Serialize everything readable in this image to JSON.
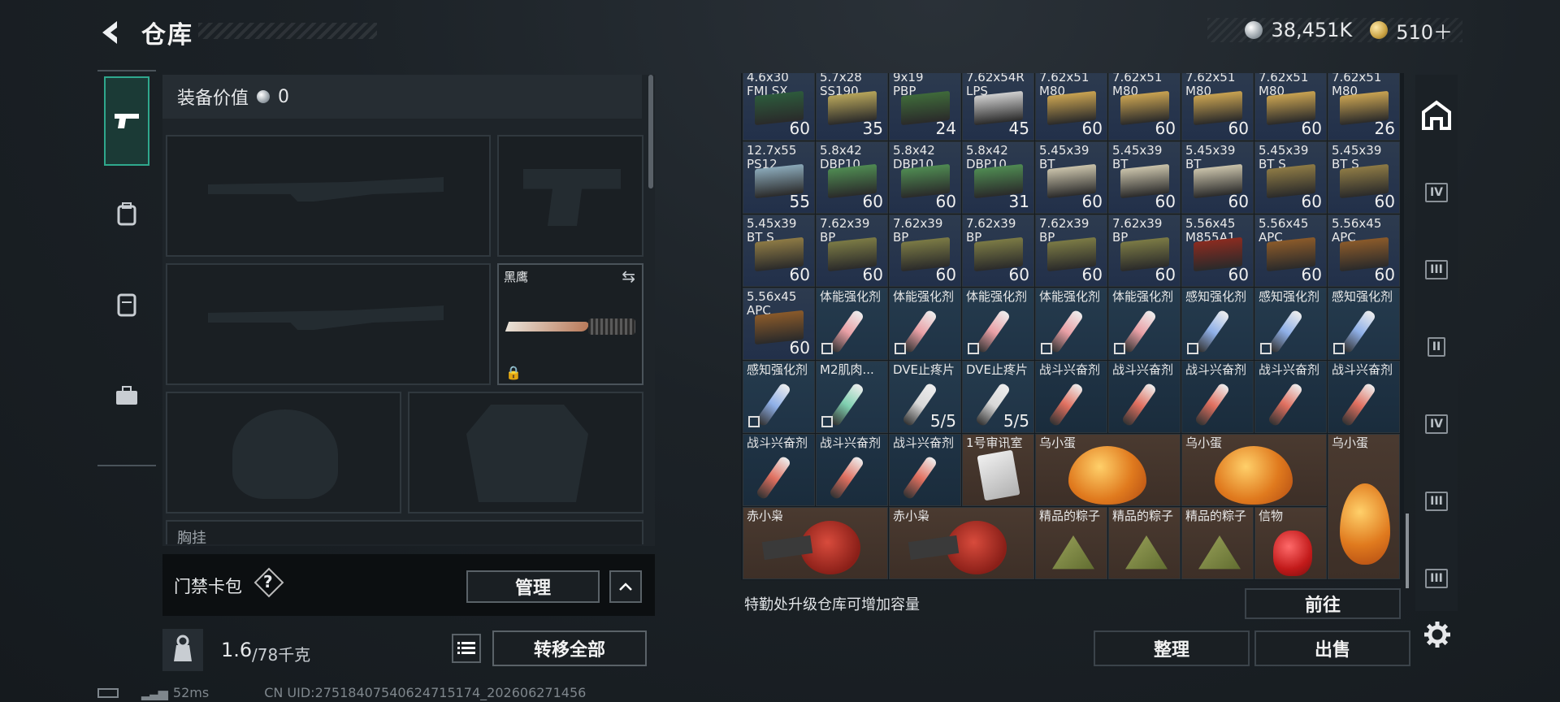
{
  "header": {
    "title": "仓库",
    "silver": "38,451K",
    "gold": "510＋"
  },
  "left_tabs": [
    {
      "name": "loadout-tab",
      "icon": "pistol-icon"
    },
    {
      "name": "backpack-tab",
      "icon": "backpack-icon"
    },
    {
      "name": "vest-tab",
      "icon": "vest-icon"
    },
    {
      "name": "case-tab",
      "icon": "briefcase-icon"
    }
  ],
  "loadout": {
    "equip_value_label": "装备价值",
    "equip_value": "0",
    "knife_name": "黑鹰",
    "chest_label": "胸挂",
    "keycard_label": "门禁卡包",
    "manage_label": "管理",
    "weight_current": "1.6",
    "weight_max": "/78千克",
    "transfer_all": "转移全部"
  },
  "grid": {
    "cells": [
      {
        "name": "4.6x30\nFMJ SX",
        "count": "60",
        "kind": "ammo",
        "box": "#2d5a3c"
      },
      {
        "name": "5.7x28\nSS190",
        "count": "35",
        "kind": "ammo",
        "box": "#b6a45a"
      },
      {
        "name": "9x19\nPBP",
        "count": "24",
        "kind": "ammo",
        "box": "#3f6a3a"
      },
      {
        "name": "7.62x54R\nLPS",
        "count": "45",
        "kind": "ammo",
        "box": "#cfcfcf"
      },
      {
        "name": "7.62x51\nM80",
        "count": "60",
        "kind": "ammo",
        "box": "#c8a251"
      },
      {
        "name": "7.62x51\nM80",
        "count": "60",
        "kind": "ammo",
        "box": "#c8a251"
      },
      {
        "name": "7.62x51\nM80",
        "count": "60",
        "kind": "ammo",
        "box": "#c8a251"
      },
      {
        "name": "7.62x51\nM80",
        "count": "60",
        "kind": "ammo",
        "box": "#c8a251"
      },
      {
        "name": "7.62x51\nM80",
        "count": "26",
        "kind": "ammo",
        "box": "#c8a251"
      },
      {
        "name": "12.7x55\nPS12",
        "count": "55",
        "kind": "ammo",
        "box": "#8aa8b8"
      },
      {
        "name": "5.8x42\nDBP10",
        "count": "60",
        "kind": "ammo",
        "box": "#4f8a52"
      },
      {
        "name": "5.8x42\nDBP10",
        "count": "60",
        "kind": "ammo",
        "box": "#4f8a52"
      },
      {
        "name": "5.8x42\nDBP10",
        "count": "31",
        "kind": "ammo",
        "box": "#4f8a52"
      },
      {
        "name": "5.45x39\nBT",
        "count": "60",
        "kind": "ammo",
        "box": "#c9c2aa"
      },
      {
        "name": "5.45x39\nBT",
        "count": "60",
        "kind": "ammo",
        "box": "#c9c2aa"
      },
      {
        "name": "5.45x39\nBT",
        "count": "60",
        "kind": "ammo",
        "box": "#c9c2aa"
      },
      {
        "name": "5.45x39\nBT S",
        "count": "60",
        "kind": "ammo",
        "box": "#8d7a45"
      },
      {
        "name": "5.45x39\nBT S",
        "count": "60",
        "kind": "ammo",
        "box": "#8d7a45"
      },
      {
        "name": "5.45x39\nBT S",
        "count": "60",
        "kind": "ammo",
        "box": "#8d7a45"
      },
      {
        "name": "7.62x39\nBP",
        "count": "60",
        "kind": "ammo",
        "box": "#7b7a45"
      },
      {
        "name": "7.62x39\nBP",
        "count": "60",
        "kind": "ammo",
        "box": "#7b7a45"
      },
      {
        "name": "7.62x39\nBP",
        "count": "60",
        "kind": "ammo",
        "box": "#7b7a45"
      },
      {
        "name": "7.62x39\nBP",
        "count": "60",
        "kind": "ammo",
        "box": "#7b7a45"
      },
      {
        "name": "7.62x39\nBP",
        "count": "60",
        "kind": "ammo",
        "box": "#7b7a45"
      },
      {
        "name": "5.56x45\nM855A1",
        "count": "60",
        "kind": "ammo",
        "box": "#8a2b20"
      },
      {
        "name": "5.56x45\nAPC",
        "count": "60",
        "kind": "ammo",
        "box": "#8a5a2a"
      },
      {
        "name": "5.56x45\nAPC",
        "count": "60",
        "kind": "ammo",
        "box": "#8a5a2a"
      },
      {
        "name": "5.56x45\nAPC",
        "count": "60",
        "kind": "ammo",
        "box": "#8a5a2a"
      },
      {
        "name": "体能强化剂",
        "count": "",
        "kind": "med",
        "syr": "#e9a0a6",
        "noicon": true
      },
      {
        "name": "体能强化剂",
        "count": "",
        "kind": "med",
        "syr": "#e9a0a6",
        "noicon": true
      },
      {
        "name": "体能强化剂",
        "count": "",
        "kind": "med",
        "syr": "#e9a0a6",
        "noicon": true
      },
      {
        "name": "体能强化剂",
        "count": "",
        "kind": "med",
        "syr": "#e9a0a6",
        "noicon": true
      },
      {
        "name": "体能强化剂",
        "count": "",
        "kind": "med",
        "syr": "#e9a0a6",
        "noicon": true
      },
      {
        "name": "感知强化剂",
        "count": "",
        "kind": "med",
        "syr": "#8fb0e8",
        "noicon": true
      },
      {
        "name": "感知强化剂",
        "count": "",
        "kind": "med",
        "syr": "#8fb0e8",
        "noicon": true
      },
      {
        "name": "感知强化剂",
        "count": "",
        "kind": "med",
        "syr": "#8fb0e8",
        "noicon": true
      },
      {
        "name": "感知强化剂",
        "count": "",
        "kind": "med",
        "syr": "#8fb0e8",
        "noicon": true
      },
      {
        "name": "M2肌肉...",
        "count": "",
        "kind": "med",
        "syr": "#7fd0b0",
        "noicon": true
      },
      {
        "name": "DVE止疼片",
        "count": "5/5",
        "kind": "med",
        "syr": "#d8d8d8"
      },
      {
        "name": "DVE止疼片",
        "count": "5/5",
        "kind": "med",
        "syr": "#d8d8d8"
      },
      {
        "name": "战斗兴奋剂",
        "count": "",
        "kind": "med2",
        "syr": "#e07060"
      },
      {
        "name": "战斗兴奋剂",
        "count": "",
        "kind": "med2",
        "syr": "#e07060"
      },
      {
        "name": "战斗兴奋剂",
        "count": "",
        "kind": "med2",
        "syr": "#e07060"
      },
      {
        "name": "战斗兴奋剂",
        "count": "",
        "kind": "med2",
        "syr": "#e07060"
      },
      {
        "name": "战斗兴奋剂",
        "count": "",
        "kind": "med2",
        "syr": "#e07060"
      },
      {
        "name": "战斗兴奋剂",
        "count": "",
        "kind": "med2",
        "syr": "#e07060"
      },
      {
        "name": "战斗兴奋剂",
        "count": "",
        "kind": "med2",
        "syr": "#e07060"
      },
      {
        "name": "战斗兴奋剂",
        "count": "",
        "kind": "med2",
        "syr": "#e07060"
      },
      {
        "name": "1号审讯室",
        "count": "",
        "kind": "brown",
        "card": true
      }
    ],
    "big_items": [
      {
        "name": "乌小蛋",
        "kind": "egg"
      },
      {
        "name": "乌小蛋",
        "kind": "egg"
      },
      {
        "name": "乌小蛋",
        "kind": "egg-tall"
      },
      {
        "name": "赤小枭",
        "kind": "owl"
      },
      {
        "name": "赤小枭",
        "kind": "owl"
      },
      {
        "name": "精品的粽子",
        "kind": "zongzi"
      },
      {
        "name": "精品的粽子",
        "kind": "zongzi"
      },
      {
        "name": "精品的粽子",
        "kind": "zongzi"
      },
      {
        "name": "信物",
        "kind": "mask"
      }
    ]
  },
  "storage": {
    "upgrade_hint": "特勤处升级仓库可增加容量",
    "goto": "前往",
    "sort": "整理",
    "sell": "出售"
  },
  "right_tabs": [
    {
      "name": "safehouse-tab",
      "label": "⌂"
    },
    {
      "name": "tier-iv-tab-1",
      "label": "IV"
    },
    {
      "name": "tier-iii-tab-1",
      "label": "III"
    },
    {
      "name": "tier-ii-tab",
      "label": "II"
    },
    {
      "name": "tier-iv-tab-2",
      "label": "IV"
    },
    {
      "name": "tier-iii-tab-2",
      "label": "III"
    },
    {
      "name": "tier-iii-tab-3",
      "label": "III"
    }
  ],
  "footer": {
    "ping": "52ms",
    "uid": "CN UID:27518407540624715174_202606271456"
  }
}
